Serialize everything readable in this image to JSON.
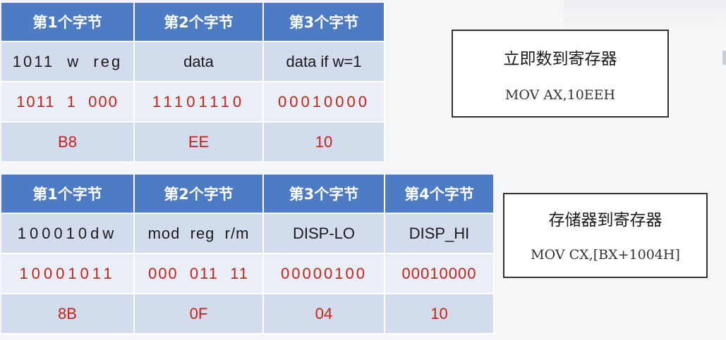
{
  "table1": {
    "headers": [
      "第1个字节",
      "第2个字节",
      "第3个字节"
    ],
    "rows": [
      [
        "1011  w  reg",
        "data",
        "data if w=1"
      ],
      [
        "1011  1  000",
        "11101110",
        "00010000"
      ],
      [
        "B8",
        "EE",
        "10"
      ]
    ]
  },
  "table2": {
    "headers": [
      "第1个字节",
      "第2个字节",
      "第3个字节",
      "第4个字节"
    ],
    "rows": [
      [
        "100010dw",
        "mod  reg  r/m",
        "DISP-LO",
        "DISP_HI"
      ],
      [
        "10001011",
        "000  011  11",
        "00000100",
        "00010000"
      ],
      [
        "8B",
        "0F",
        "04",
        "10"
      ]
    ]
  },
  "box1": {
    "title": "立即数到寄存器",
    "code": "MOV AX,10EEH"
  },
  "box2": {
    "title": "存储器到寄存器",
    "code": "MOV CX,[BX+1004H]"
  },
  "colors": {
    "header_bg": "#4d7cc4",
    "row_dark": "#d3dced",
    "row_light": "#eaeef6",
    "binary_red": "#c8211a"
  }
}
